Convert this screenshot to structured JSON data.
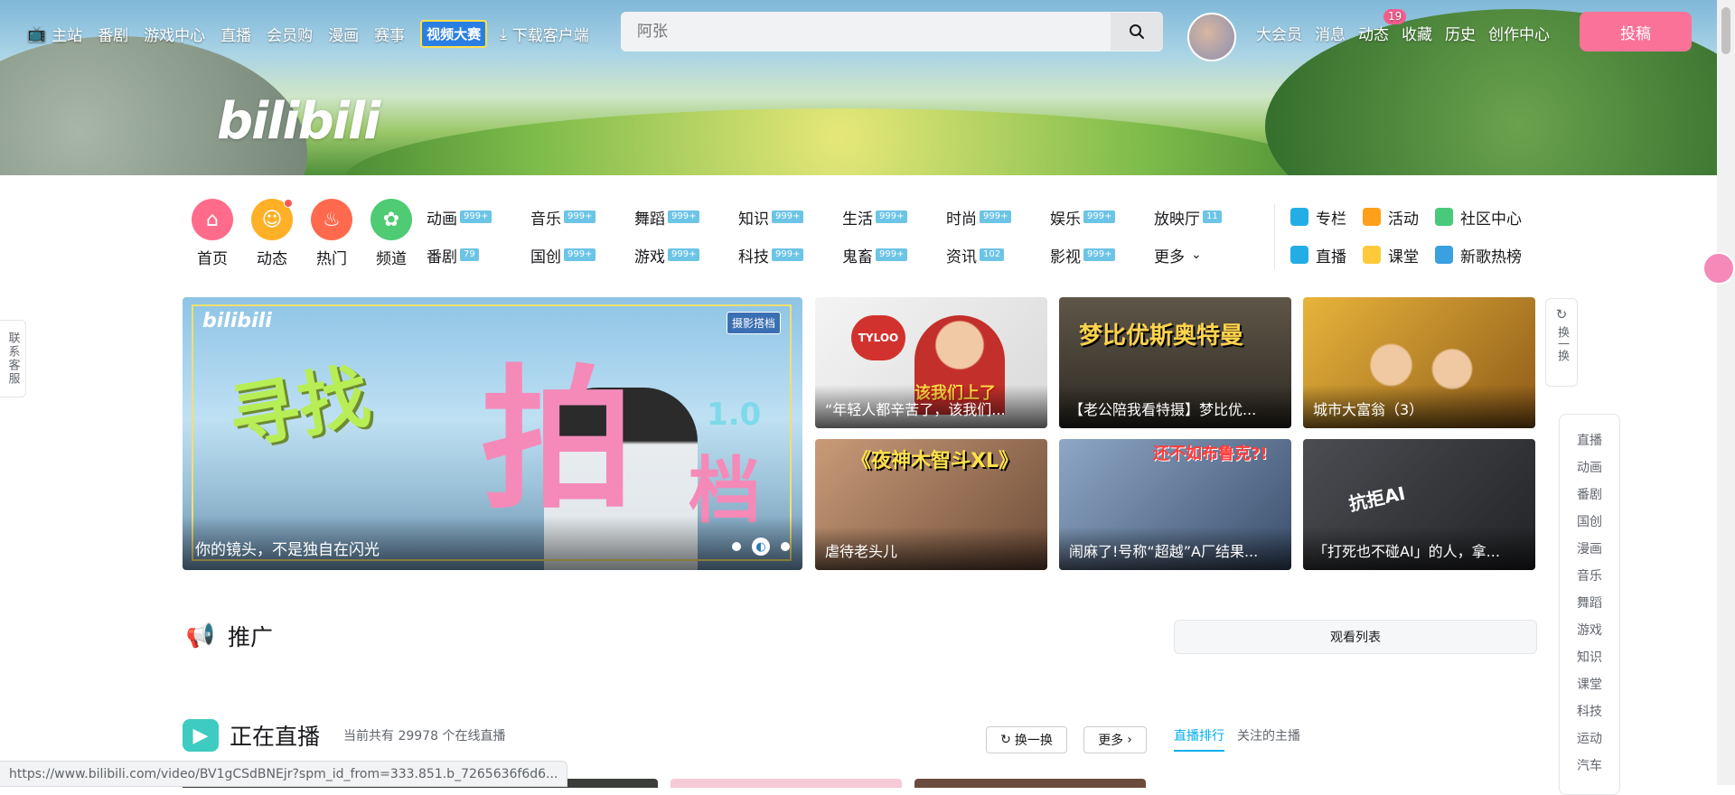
{
  "top_nav": {
    "items": [
      "主站",
      "番剧",
      "游戏中心",
      "直播",
      "会员购",
      "漫画",
      "赛事"
    ],
    "event_badge": "视频大赛",
    "download": "下载客户端"
  },
  "search": {
    "placeholder": "阿张"
  },
  "user_nav": {
    "items": [
      "大会员",
      "消息",
      "动态",
      "收藏",
      "历史",
      "创作中心"
    ],
    "dynamic_count": "19",
    "upload": "投稿"
  },
  "logo_text": "bilibili",
  "quick_entries": [
    {
      "label": "首页",
      "icon": "home-icon",
      "color": "#ff6b8b"
    },
    {
      "label": "动态",
      "icon": "dynamic-icon",
      "color": "#ffb027"
    },
    {
      "label": "热门",
      "icon": "fire-icon",
      "color": "#ff6a4f"
    },
    {
      "label": "频道",
      "icon": "channel-icon",
      "color": "#4fcb73"
    }
  ],
  "categories": [
    {
      "name": "动画",
      "count": "999+"
    },
    {
      "name": "音乐",
      "count": "999+"
    },
    {
      "name": "舞蹈",
      "count": "999+"
    },
    {
      "name": "知识",
      "count": "999+"
    },
    {
      "name": "生活",
      "count": "999+"
    },
    {
      "name": "时尚",
      "count": "999+"
    },
    {
      "name": "娱乐",
      "count": "999+"
    },
    {
      "name": "放映厅",
      "count": "11"
    },
    {
      "name": "番剧",
      "count": "79"
    },
    {
      "name": "国创",
      "count": "999+"
    },
    {
      "name": "游戏",
      "count": "999+"
    },
    {
      "name": "科技",
      "count": "999+"
    },
    {
      "name": "鬼畜",
      "count": "999+"
    },
    {
      "name": "资讯",
      "count": "102"
    },
    {
      "name": "影视",
      "count": "999+"
    },
    {
      "name": "更多",
      "count": ""
    }
  ],
  "side_links": [
    {
      "label": "专栏",
      "color": "#23ade5"
    },
    {
      "label": "活动",
      "color": "#ff9f1a"
    },
    {
      "label": "社区中心",
      "color": "#49c97c"
    },
    {
      "label": "直播",
      "color": "#23ade5"
    },
    {
      "label": "课堂",
      "color": "#ffc93c"
    },
    {
      "label": "新歌热榜",
      "color": "#3aa0e0"
    }
  ],
  "carousel": {
    "logo": "bilibili",
    "tag": "摄影搭档",
    "headline_a": "寻找",
    "headline_b": "拍",
    "headline_c": "档",
    "version": "1.0",
    "caption": "你的镜头，不是独自在闪光"
  },
  "videos": [
    {
      "title": "“年轻人都辛苦了，该我们...",
      "overlay": "该我们上了",
      "bg": "#ebebeb"
    },
    {
      "title": "【老公陪我看特摄】梦比优...",
      "overlay": "梦比优斯奥特曼",
      "bg": "#4a4135"
    },
    {
      "title": "城市大富翁（3）",
      "overlay": "",
      "bg": "#c9902c"
    },
    {
      "title": "虐待老头儿",
      "overlay": "《夜神木智斗XL》",
      "bg": "#b58d6e"
    },
    {
      "title": "闹麻了!号称“超越”A厂结果...",
      "overlay": "还不如布鲁克?!",
      "bg": "#5a6f8f"
    },
    {
      "title": "「打死也不碰AI」的人，拿...",
      "overlay": "抗拒AI",
      "bg": "#3d3f44"
    }
  ],
  "refresh": {
    "label": "换一换"
  },
  "customer_service": "联系客服",
  "right_nav": [
    "直播",
    "动画",
    "番剧",
    "国创",
    "漫画",
    "音乐",
    "舞蹈",
    "游戏",
    "知识",
    "课堂",
    "科技",
    "运动",
    "汽车"
  ],
  "promo": {
    "title": "推广",
    "watchlist": "观看列表"
  },
  "live": {
    "title": "正在直播",
    "summary": "当前共有 29978 个在线直播",
    "refresh": "换一换",
    "more": "更多",
    "tab_rank": "直播排行",
    "tab_follow": "关注的主播"
  },
  "status_url": "https://www.bilibili.com/video/BV1gCSdBNEjr?spm_id_from=333.851.b_7265636f6d6..."
}
